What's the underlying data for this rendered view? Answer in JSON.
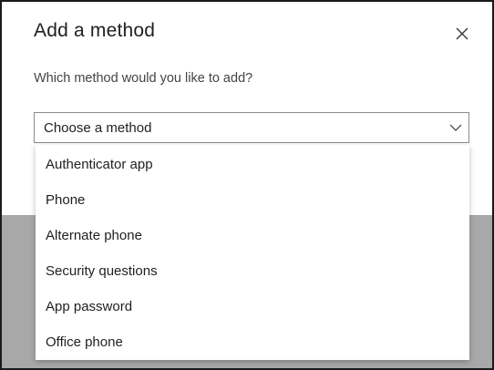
{
  "dialog": {
    "title": "Add a method",
    "close_icon": "close-icon",
    "prompt": "Which method would you like to add?"
  },
  "select": {
    "value": "Choose a method",
    "chevron_icon": "chevron-down-icon"
  },
  "menu": {
    "options": [
      "Authenticator app",
      "Phone",
      "Alternate phone",
      "Security questions",
      "App password",
      "Office phone"
    ]
  },
  "colors": {
    "overlay": "#a8a8a8",
    "border": "#8a8a8a",
    "text": "#1f1f1f"
  }
}
